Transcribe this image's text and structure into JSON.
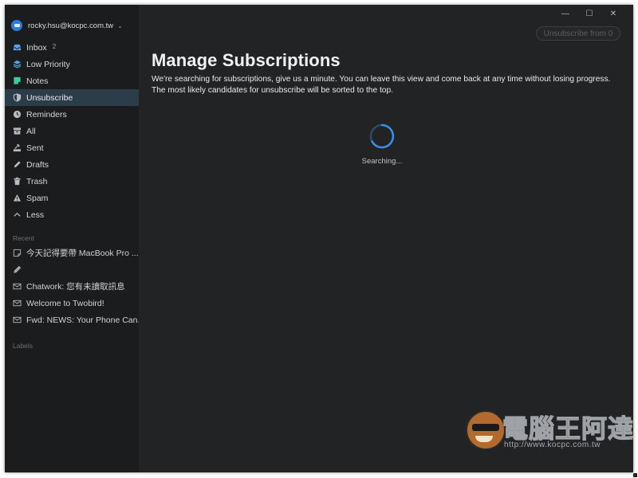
{
  "account": {
    "email": "rocky.hsu@kocpc.com.tw"
  },
  "nav": [
    {
      "label": "Inbox",
      "icon": "inbox-icon",
      "badge": "2",
      "color": "#5aa3e8"
    },
    {
      "label": "Low Priority",
      "icon": "layers-icon",
      "color": "#5aa3e8"
    },
    {
      "label": "Notes",
      "icon": "notes-icon",
      "color": "#3fc7a0"
    },
    {
      "label": "Unsubscribe",
      "icon": "shield-icon",
      "active": true,
      "color": "#b9bcbf"
    },
    {
      "label": "Reminders",
      "icon": "clock-icon",
      "color": "#b9bcbf"
    },
    {
      "label": "All",
      "icon": "archive-icon",
      "color": "#b9bcbf"
    },
    {
      "label": "Sent",
      "icon": "sent-icon",
      "color": "#b9bcbf"
    },
    {
      "label": "Drafts",
      "icon": "pencil-icon",
      "color": "#b9bcbf"
    },
    {
      "label": "Trash",
      "icon": "trash-icon",
      "color": "#b9bcbf"
    },
    {
      "label": "Spam",
      "icon": "warning-icon",
      "color": "#b9bcbf"
    },
    {
      "label": "Less",
      "icon": "chevron-up-icon",
      "color": "#b9bcbf"
    }
  ],
  "recent_label": "Recent",
  "recent": [
    {
      "label": "今天記得要帶 MacBook Pro ...",
      "icon": "note-icon"
    },
    {
      "label": "",
      "icon": "pencil-icon"
    },
    {
      "label": "Chatwork: 您有未讀取訊息",
      "icon": "mail-icon"
    },
    {
      "label": "Welcome to Twobird!",
      "icon": "mail-icon"
    },
    {
      "label": "Fwd: NEWS: Your Phone Can...",
      "icon": "mail-icon"
    }
  ],
  "labels_label": "Labels",
  "window_controls": {
    "minimize": "—",
    "maximize": "☐",
    "close": "✕"
  },
  "main": {
    "unsubscribe_button": "Unsubscribe from 0",
    "title": "Manage Subscriptions",
    "description": "We're searching for subscriptions, give us a minute. You can leave this view and come back at any time without losing progress. The most likely candidates for unsubscribe will be sorted to the top.",
    "status": "Searching..."
  },
  "watermark": {
    "title": "電腦王阿達",
    "url": "http://www.kocpc.com.tw"
  },
  "colors": {
    "background": "#222324",
    "sidebar": "#1b1c1d",
    "active_row": "#2c3d4a",
    "accent": "#3a8ee6"
  }
}
